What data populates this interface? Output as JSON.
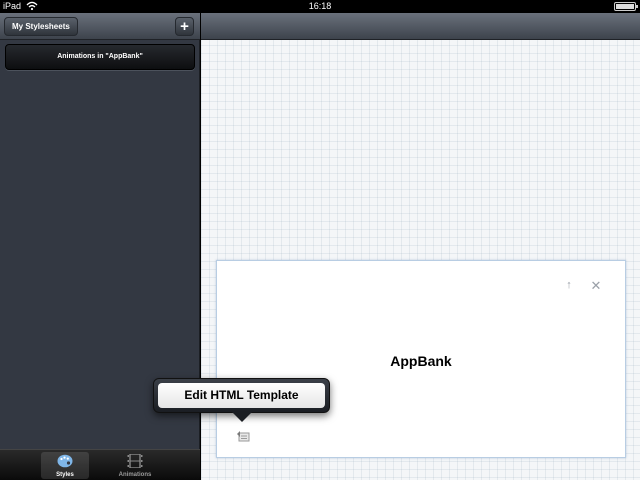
{
  "status_bar": {
    "device": "iPad",
    "time": "16:18"
  },
  "sidebar": {
    "stylesheets_button": "My Stylesheets",
    "add_button": "+",
    "items": [
      {
        "label": "Animations in \"AppBank\""
      }
    ]
  },
  "tabbar": {
    "tabs": [
      {
        "label": "Styles",
        "icon": "palette-icon",
        "active": true
      },
      {
        "label": "Animations",
        "icon": "film-icon",
        "active": false
      }
    ]
  },
  "canvas": {
    "card": {
      "title": "AppBank",
      "icons": [
        "arrow-up-icon",
        "close-icon",
        "template-icon"
      ]
    }
  },
  "popover": {
    "label": "Edit HTML Template"
  }
}
